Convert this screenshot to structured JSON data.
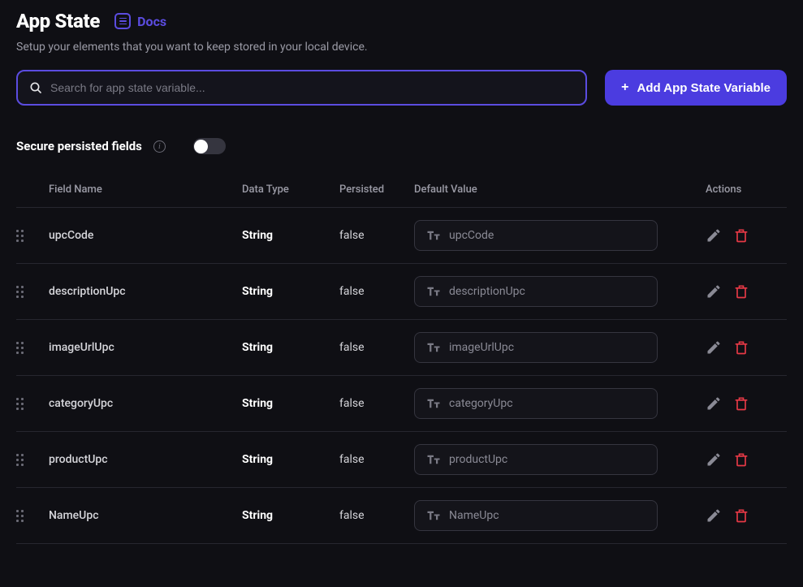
{
  "header": {
    "title": "App State",
    "docs_label": "Docs",
    "subtitle": "Setup your elements that you want to keep stored in your local device."
  },
  "search": {
    "placeholder": "Search for app state variable..."
  },
  "add_button": {
    "label": "Add App State Variable"
  },
  "secure": {
    "label": "Secure persisted fields",
    "enabled": false
  },
  "columns": {
    "field_name": "Field Name",
    "data_type": "Data Type",
    "persisted": "Persisted",
    "default_value": "Default Value",
    "actions": "Actions"
  },
  "rows": [
    {
      "field_name": "upcCode",
      "data_type": "String",
      "persisted": "false",
      "default_value": "upcCode"
    },
    {
      "field_name": "descriptionUpc",
      "data_type": "String",
      "persisted": "false",
      "default_value": "descriptionUpc"
    },
    {
      "field_name": "imageUrlUpc",
      "data_type": "String",
      "persisted": "false",
      "default_value": "imageUrlUpc"
    },
    {
      "field_name": "categoryUpc",
      "data_type": "String",
      "persisted": "false",
      "default_value": "categoryUpc"
    },
    {
      "field_name": "productUpc",
      "data_type": "String",
      "persisted": "false",
      "default_value": "productUpc"
    },
    {
      "field_name": "NameUpc",
      "data_type": "String",
      "persisted": "false",
      "default_value": "NameUpc"
    }
  ]
}
